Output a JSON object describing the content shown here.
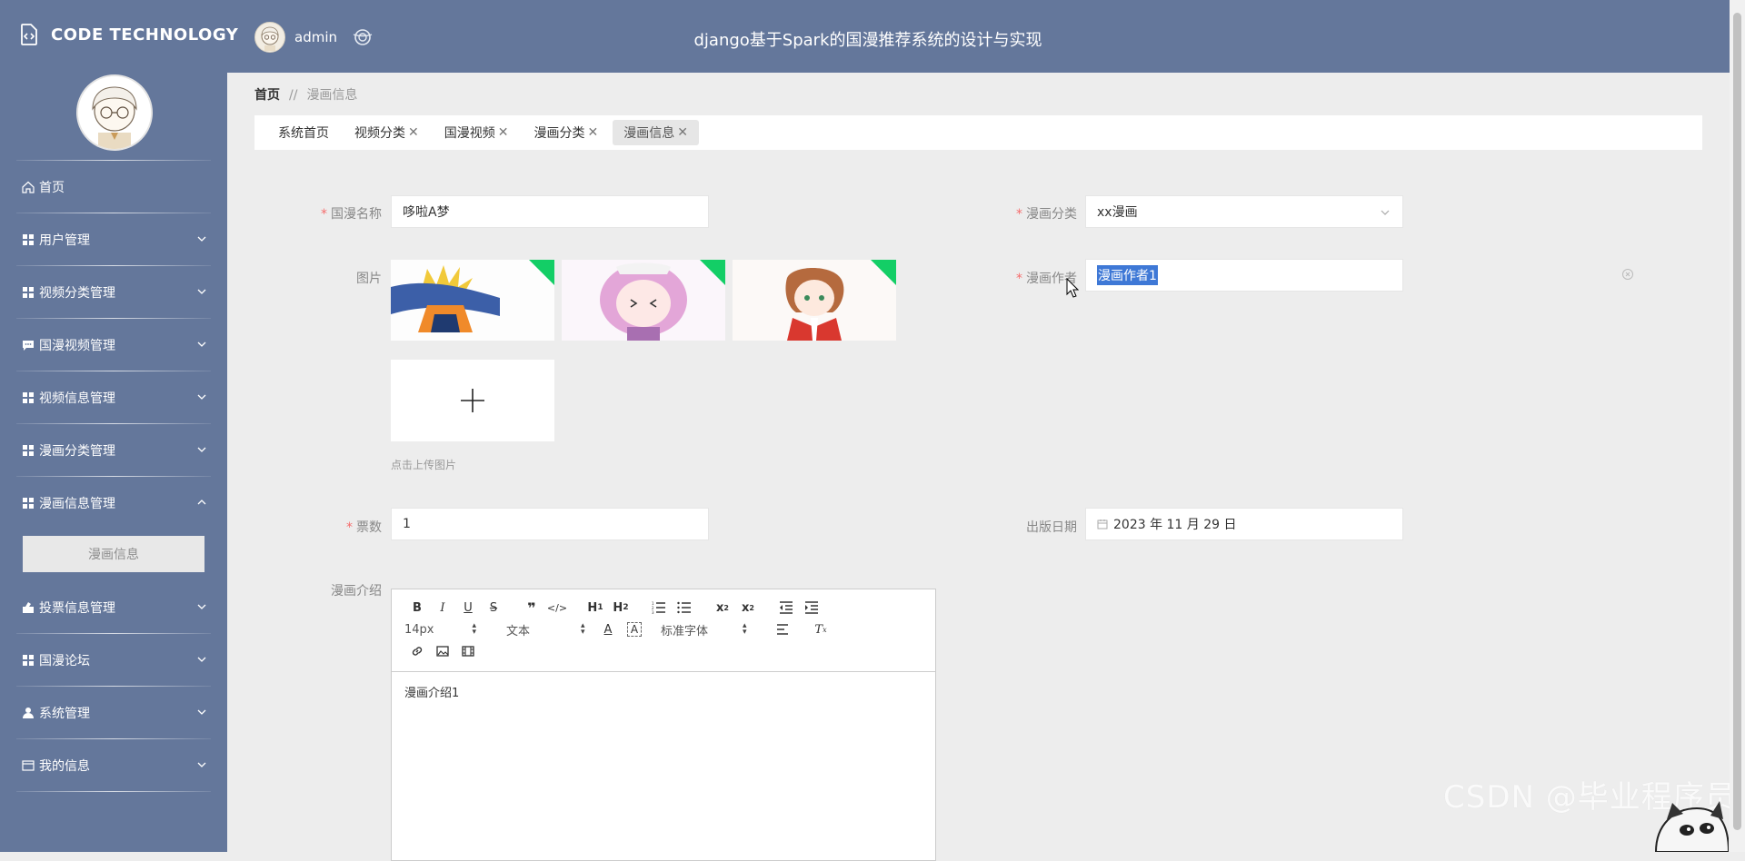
{
  "header": {
    "brand": "CODE TECHNOLOGY",
    "username": "admin",
    "title": "django基于Spark的国漫推荐系统的设计与实现"
  },
  "sidebar": {
    "items": [
      {
        "label": "首页",
        "icon": "home-icon"
      },
      {
        "label": "用户管理",
        "icon": "grid-icon"
      },
      {
        "label": "视频分类管理",
        "icon": "grid-icon"
      },
      {
        "label": "国漫视频管理",
        "icon": "chat-icon"
      },
      {
        "label": "视频信息管理",
        "icon": "grid-icon"
      },
      {
        "label": "漫画分类管理",
        "icon": "grid-icon"
      },
      {
        "label": "漫画信息管理",
        "icon": "grid-icon",
        "expanded": true
      },
      {
        "label": "投票信息管理",
        "icon": "vote-icon"
      },
      {
        "label": "国漫论坛",
        "icon": "grid-icon"
      },
      {
        "label": "系统管理",
        "icon": "user-icon"
      },
      {
        "label": "我的信息",
        "icon": "card-icon"
      }
    ],
    "sub_item": "漫画信息"
  },
  "breadcrumb": {
    "home": "首页",
    "separator": "//",
    "current": "漫画信息"
  },
  "tabs": [
    {
      "label": "系统首页",
      "closable": false
    },
    {
      "label": "视频分类",
      "closable": true
    },
    {
      "label": "国漫视频",
      "closable": true
    },
    {
      "label": "漫画分类",
      "closable": true
    },
    {
      "label": "漫画信息",
      "closable": true,
      "active": true
    }
  ],
  "form": {
    "name_label": "国漫名称",
    "name_value": "哆啦A梦",
    "category_label": "漫画分类",
    "category_value": "xx漫画",
    "image_label": "图片",
    "author_label": "漫画作者",
    "author_value": "漫画作者1",
    "upload_tip": "点击上传图片",
    "votes_label": "票数",
    "votes_value": "1",
    "date_label": "出版日期",
    "date_value": "2023 年 11 月 29 日",
    "intro_label": "漫画介绍"
  },
  "editor": {
    "font_size": "14px",
    "paragraph": "文本",
    "font_family": "标准字体",
    "content": "漫画介绍1"
  },
  "watermark": "CSDN @毕业程序员",
  "colors": {
    "sidebar": "#64779b",
    "accent_green": "#13ce66",
    "required": "#f56c6c"
  }
}
